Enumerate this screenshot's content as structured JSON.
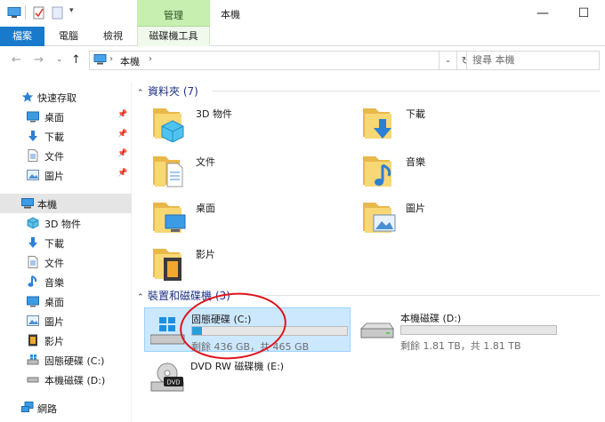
{
  "window": {
    "title": "本機",
    "context_tab": "管理",
    "minimize_glyph": "—",
    "maximize_glyph": "☐"
  },
  "ribbon": {
    "file_tab": "檔案",
    "tabs": [
      "電腦",
      "檢視"
    ],
    "context_subtab": "磁碟機工具"
  },
  "nav": {
    "breadcrumb": [
      "本機"
    ],
    "search_placeholder": "搜尋 本機"
  },
  "sidebar": {
    "quick_access": "快速存取",
    "pinned": [
      "桌面",
      "下載",
      "文件",
      "圖片"
    ],
    "this_pc": "本機",
    "pc_items": [
      "3D 物件",
      "下載",
      "文件",
      "音樂",
      "桌面",
      "圖片",
      "影片",
      "固態硬碟 (C:)",
      "本機磁碟 (D:)"
    ],
    "network": "網路"
  },
  "main": {
    "folders_header": "資料夾 (7)",
    "folders": [
      "3D 物件",
      "下載",
      "文件",
      "音樂",
      "桌面",
      "圖片",
      "影片"
    ],
    "devices_header": "裝置和磁碟機 (3)",
    "drives": [
      {
        "name": "固態硬碟 (C:)",
        "info": "剩餘 436 GB，共 465 GB",
        "used_fraction": 0.063
      },
      {
        "name": "本機磁碟 (D:)",
        "info": "剩餘 1.81 TB，共 1.81 TB",
        "used_fraction": 0.0
      }
    ],
    "dvd": {
      "name": "DVD RW 磁碟機 (E:)",
      "label": "DVD"
    }
  },
  "colors": {
    "accent": "#1979ca",
    "context_tab": "#c6efb0",
    "selection": "#cce8ff",
    "bar_fill": "#26a0da",
    "folder": "#f8d775",
    "highlight_ring": "#e0131b",
    "group_header": "#1e3287"
  }
}
